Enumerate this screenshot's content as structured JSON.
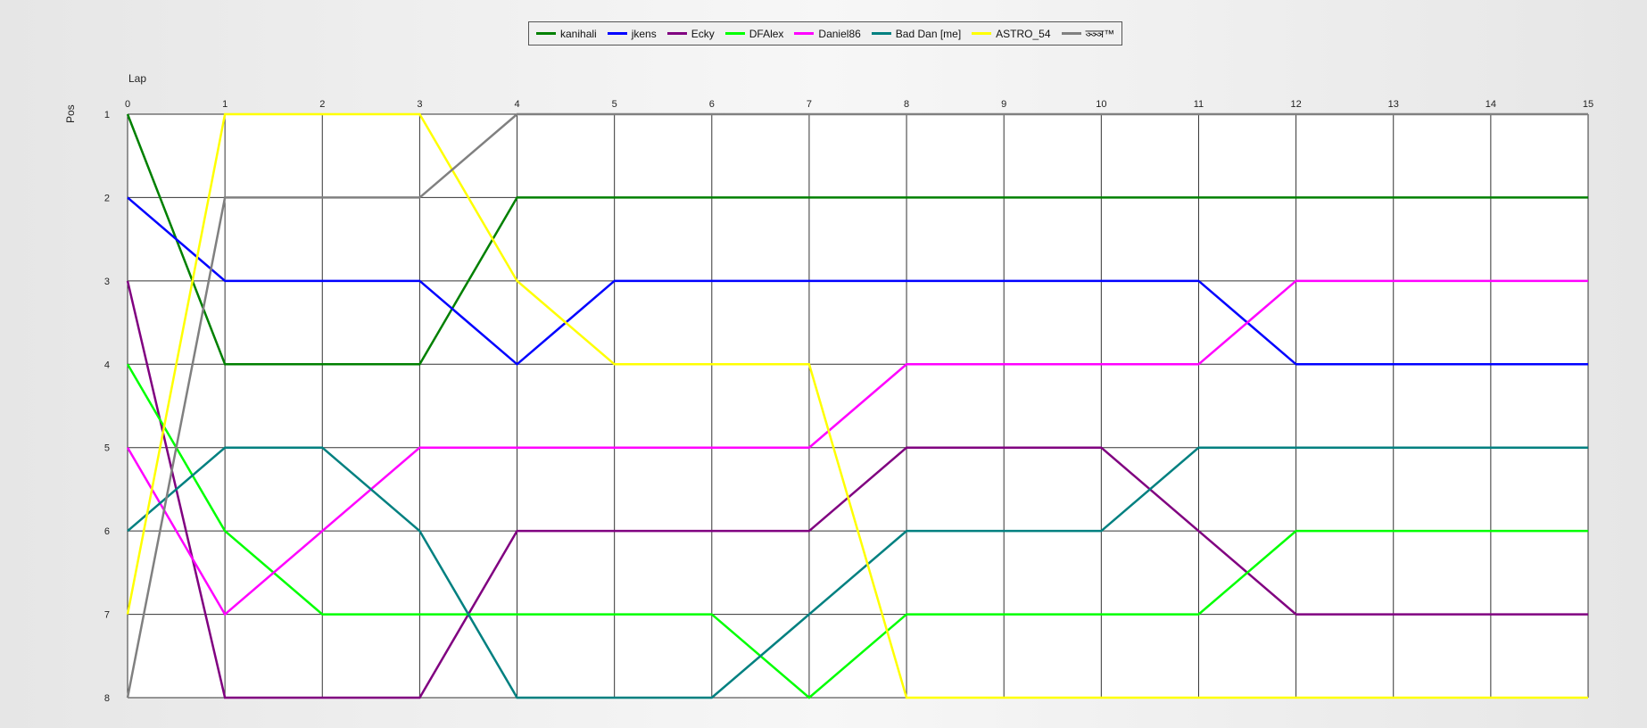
{
  "chart_data": {
    "type": "line",
    "xlabel": "Lap",
    "ylabel": "Pos",
    "xlim": [
      0,
      15
    ],
    "ylim": [
      1,
      8
    ],
    "y_inverted": true,
    "grid": true,
    "legend_position": "top-center",
    "x": [
      0,
      1,
      2,
      3,
      4,
      5,
      6,
      7,
      8,
      9,
      10,
      11,
      12,
      13,
      14,
      15
    ],
    "x_ticks": [
      "0",
      "1",
      "2",
      "3",
      "4",
      "5",
      "6",
      "7",
      "8",
      "9",
      "10",
      "11",
      "12",
      "13",
      "14",
      "15"
    ],
    "y_ticks": [
      "1",
      "2",
      "3",
      "4",
      "5",
      "6",
      "7",
      "8"
    ],
    "series": [
      {
        "name": "kanihali",
        "color": "#008000",
        "values": [
          1,
          4,
          4,
          4,
          2,
          2,
          2,
          2,
          2,
          2,
          2,
          2,
          2,
          2,
          2,
          2
        ]
      },
      {
        "name": "jkens",
        "color": "#0000ff",
        "values": [
          2,
          3,
          3,
          3,
          4,
          3,
          3,
          3,
          3,
          3,
          3,
          3,
          4,
          4,
          4,
          4
        ]
      },
      {
        "name": "Ecky",
        "color": "#800080",
        "values": [
          3,
          8,
          8,
          8,
          6,
          6,
          6,
          6,
          5,
          5,
          5,
          6,
          7,
          7,
          7,
          7
        ]
      },
      {
        "name": "DFAlex",
        "color": "#00ff00",
        "values": [
          4,
          6,
          7,
          7,
          7,
          7,
          7,
          8,
          7,
          7,
          7,
          7,
          6,
          6,
          6,
          6
        ]
      },
      {
        "name": "Daniel86",
        "color": "#ff00ff",
        "values": [
          5,
          7,
          6,
          5,
          5,
          5,
          5,
          5,
          4,
          4,
          4,
          4,
          3,
          3,
          3,
          3
        ]
      },
      {
        "name": "Bad Dan [me]",
        "color": "#008080",
        "values": [
          6,
          5,
          5,
          6,
          8,
          8,
          8,
          7,
          6,
          6,
          6,
          5,
          5,
          5,
          5,
          5
        ]
      },
      {
        "name": "ASTRO_54",
        "color": "#ffff00",
        "values": [
          7,
          1,
          1,
          1,
          3,
          4,
          4,
          4,
          8,
          8,
          8,
          8,
          8,
          8,
          8,
          8
        ]
      },
      {
        "name": "ञ्ञ्ञ™",
        "color": "#808080",
        "values": [
          8,
          2,
          2,
          2,
          1,
          1,
          1,
          1,
          1,
          1,
          1,
          1,
          1,
          1,
          1,
          1
        ]
      }
    ]
  }
}
